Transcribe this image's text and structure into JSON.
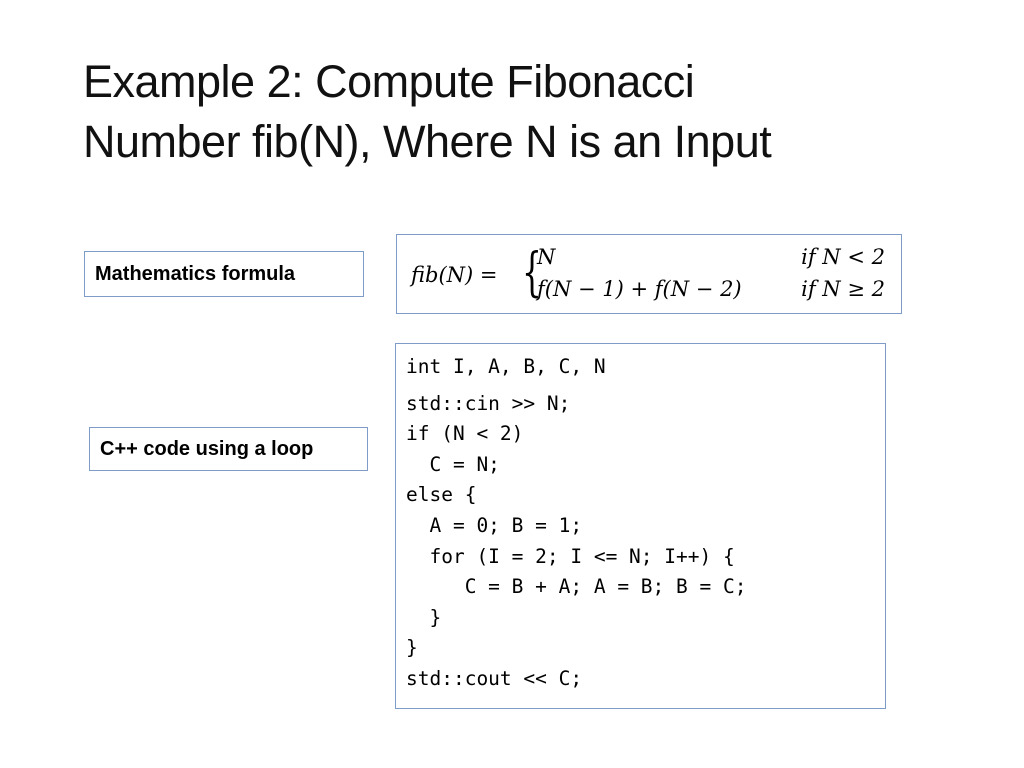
{
  "slide": {
    "title_line1": "Example 2: Compute Fibonacci",
    "title_line2": "Number fib(N), Where N is an Input"
  },
  "labels": {
    "math": "Mathematics formula",
    "code": "C++ code using a loop"
  },
  "formula": {
    "lhs": "fib(N) =",
    "case1_expr": "N",
    "case1_cond": "if N < 2",
    "case2_expr": "f(N − 1) + f(N − 2)",
    "case2_cond": "if N ≥ 2"
  },
  "code": {
    "lines": [
      "int I, A, B, C, N",
      "std::cin >> N;",
      "if (N < 2)",
      "  C = N;",
      "else {",
      "  A = 0; B = 1;",
      "  for (I = 2; I <= N; I++) {",
      "     C = B + A; A = B; B = C;",
      "  }",
      "}",
      "std::cout << C;"
    ]
  },
  "colors": {
    "box_border": "#7f9bc8"
  }
}
